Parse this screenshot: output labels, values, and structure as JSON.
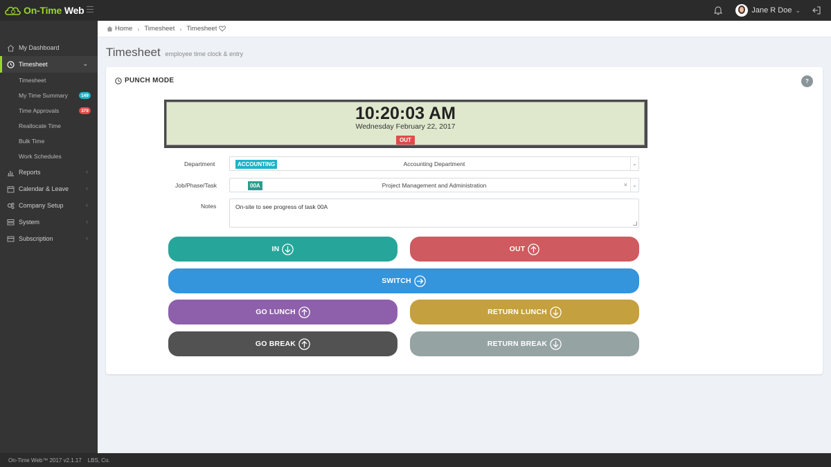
{
  "brand": {
    "name_part1": "On-Time",
    "name_part2": " Web"
  },
  "topbar": {
    "user_name": "Jane R Doe"
  },
  "sidebar": {
    "items": [
      {
        "label": "My Dashboard",
        "icon": "home-icon"
      },
      {
        "label": "Timesheet",
        "icon": "clock-icon",
        "active": true
      },
      {
        "label": "Reports",
        "icon": "bar-chart-icon"
      },
      {
        "label": "Calendar & Leave",
        "icon": "calendar-icon"
      },
      {
        "label": "Company Setup",
        "icon": "gears-icon"
      },
      {
        "label": "System",
        "icon": "server-icon"
      },
      {
        "label": "Subscription",
        "icon": "credit-card-icon"
      }
    ],
    "subitems": [
      {
        "label": "Timesheet"
      },
      {
        "label": "My Time Summary",
        "badge": "149",
        "badge_color": "#1fb3c9"
      },
      {
        "label": "Time Approvals",
        "badge": "379",
        "badge_color": "#e04b4b"
      },
      {
        "label": "Reallocate Time"
      },
      {
        "label": "Bulk Time"
      },
      {
        "label": "Work Schedules"
      }
    ]
  },
  "breadcrumb": {
    "home": "Home",
    "level1": "Timesheet",
    "level2": "Timesheet"
  },
  "page": {
    "title": "Timesheet",
    "subtitle": "employee time clock & entry"
  },
  "panel": {
    "title": "PUNCH MODE",
    "help": "?",
    "clock": {
      "time": "10:20:03 AM",
      "date": "Wednesday February 22, 2017",
      "status": "OUT"
    },
    "department": {
      "label": "Department",
      "code": "ACCOUNTING",
      "name": "Accounting Department"
    },
    "job": {
      "label": "Job/Phase/Task",
      "code": "00A",
      "name": "Project Management and Administration"
    },
    "notes": {
      "label": "Notes",
      "value": "On-site to see progress of task 00A"
    },
    "buttons": {
      "in": "IN",
      "out": "OUT",
      "switch": "SWITCH",
      "go_lunch": "GO LUNCH",
      "return_lunch": "RETURN LUNCH",
      "go_break": "GO BREAK",
      "return_break": "RETURN BREAK"
    }
  },
  "footer": {
    "text": "On-Time Web™ 2017 v2.1.17    LBS, Co."
  },
  "colors": {
    "accent": "#9bd42a",
    "in": "#26a69a",
    "out": "#cf5a5f",
    "switch": "#3494dc",
    "go_lunch": "#8e60ab",
    "return_lunch": "#c4a03f",
    "go_break": "#525252",
    "return_break": "#96a3a3"
  }
}
